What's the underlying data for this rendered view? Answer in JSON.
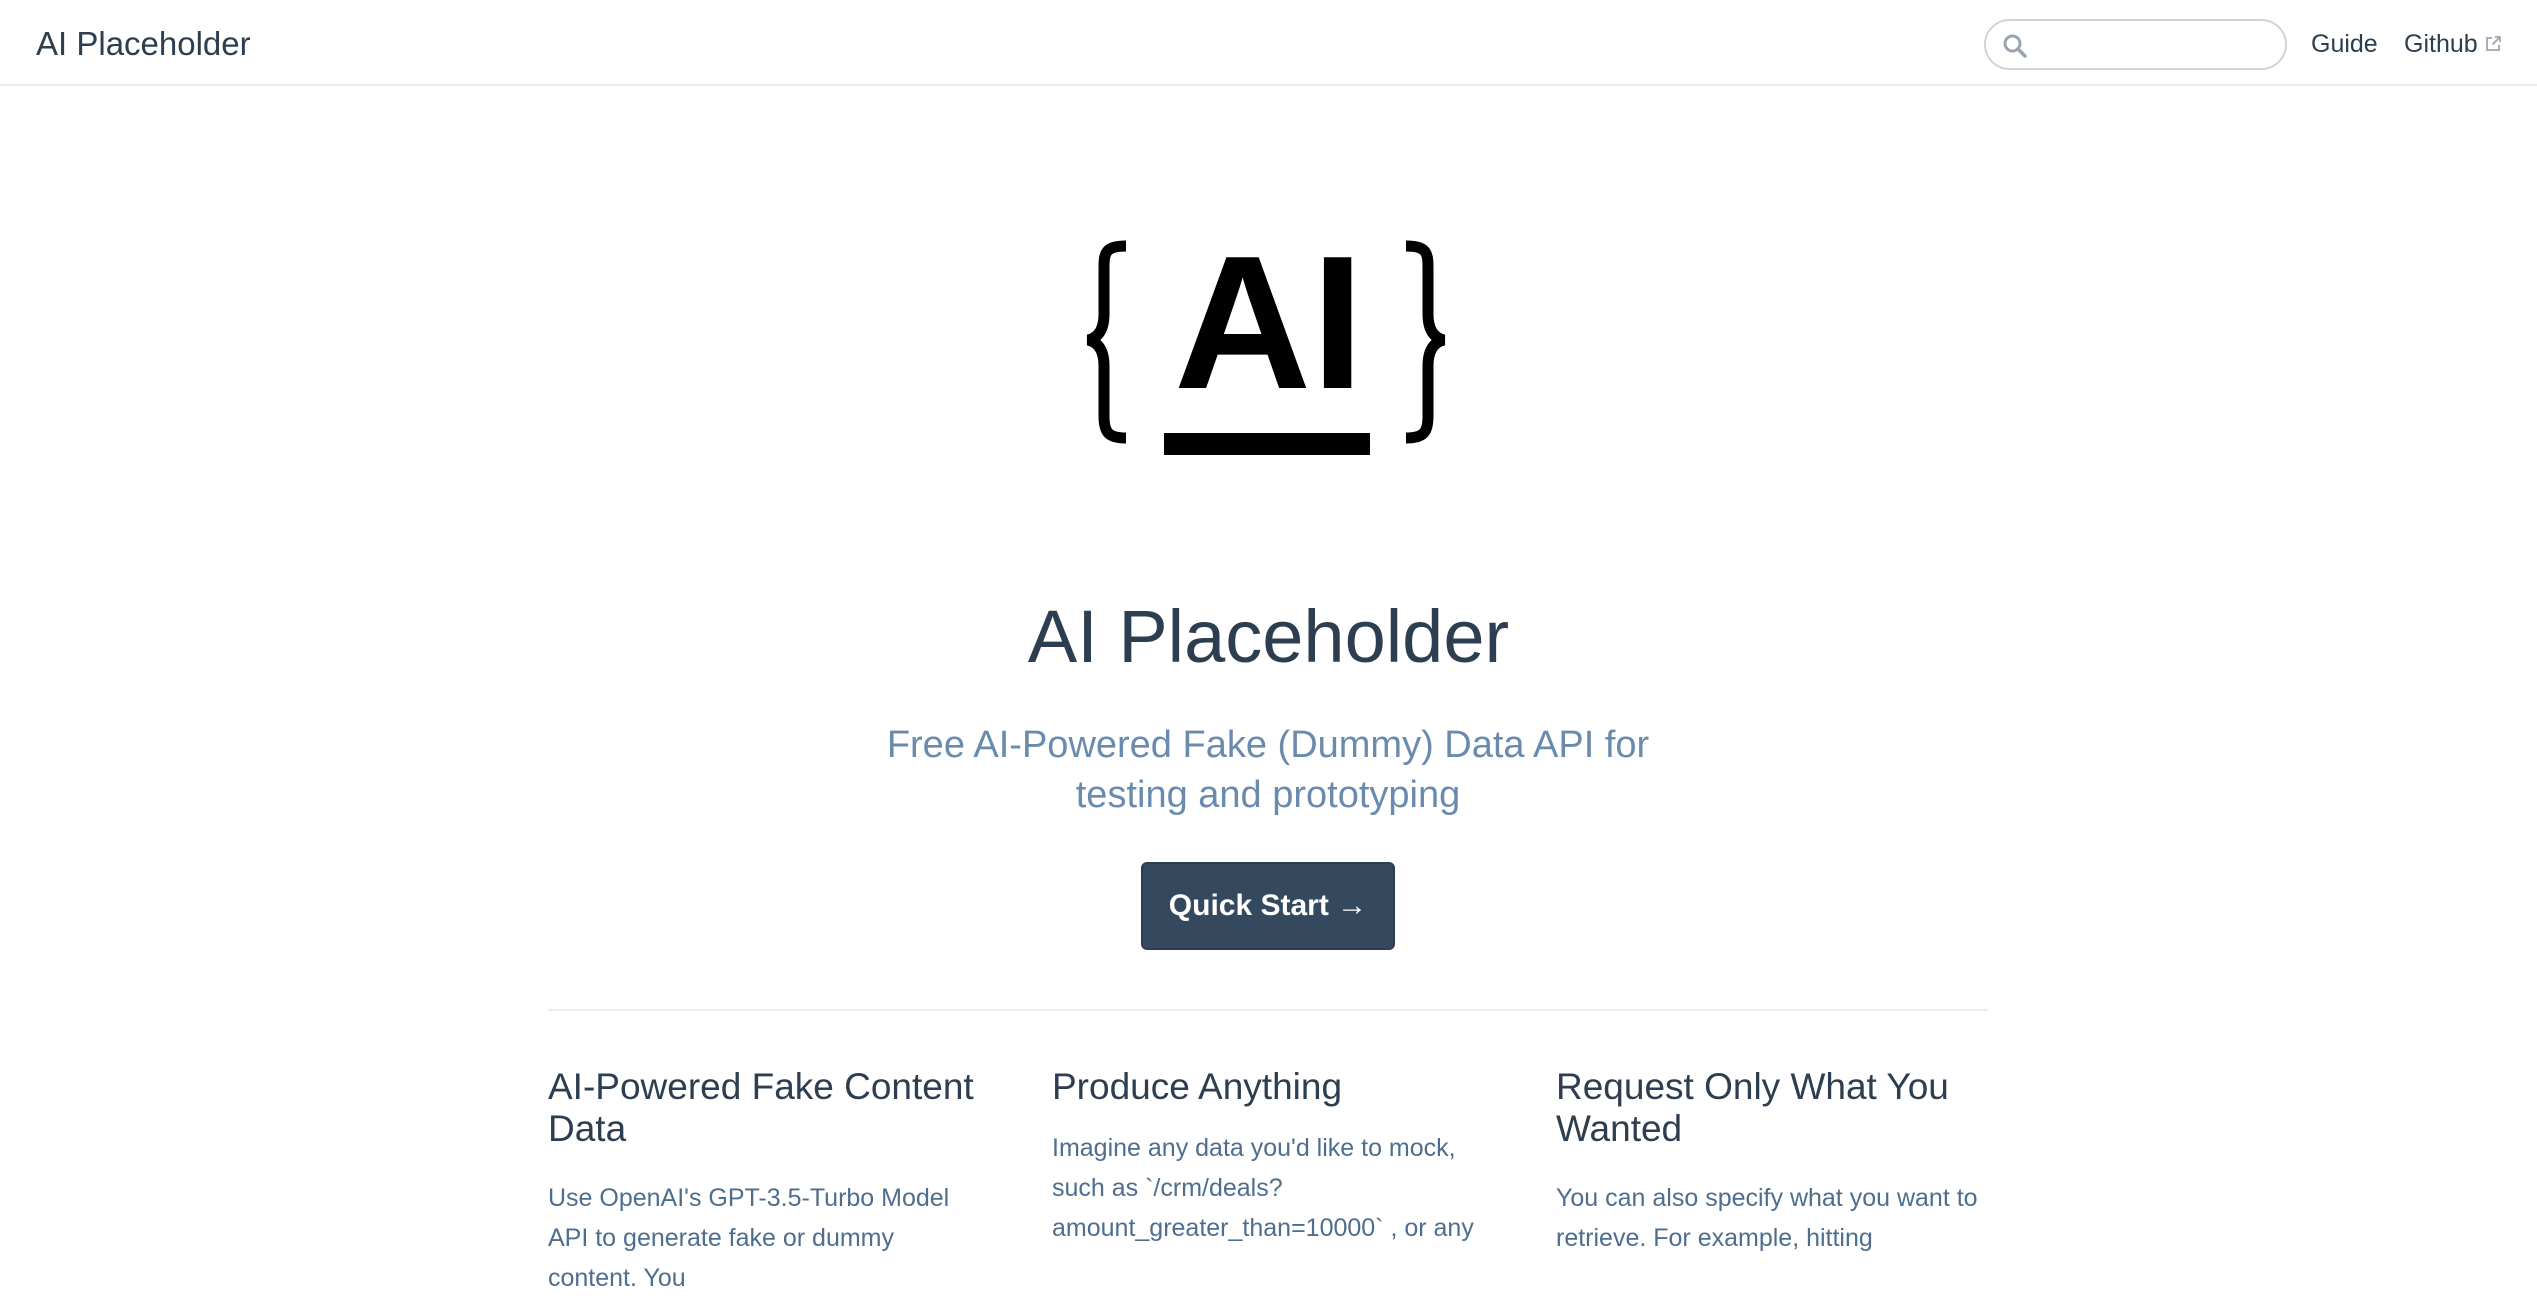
{
  "navbar": {
    "site_name": "AI Placeholder",
    "search_placeholder": "",
    "links": [
      {
        "label": "Guide"
      },
      {
        "label": "Github",
        "icon": "external-link-icon"
      }
    ]
  },
  "hero": {
    "logo_text": "AI",
    "title": "AI Placeholder",
    "tagline": "Free AI-Powered Fake (Dummy) Data API for testing and prototyping",
    "cta_label": "Quick Start →"
  },
  "features": [
    {
      "title": "AI-Powered Fake Content Data",
      "text": "Use OpenAI's GPT-3.5-Turbo Model API to generate fake or dummy content. You"
    },
    {
      "title": "Produce Anything",
      "text": "Imagine any data you'd like to mock, such as `/crm/deals?amount_greater_than=10000` , or any"
    },
    {
      "title": "Request Only What You Wanted",
      "text": "You can also specify what you want to retrieve. For example, hitting"
    }
  ],
  "colors": {
    "text": "#2c3e50",
    "tagline": "#6a8bad",
    "button_bg": "#34495e",
    "border": "#eaecef"
  }
}
